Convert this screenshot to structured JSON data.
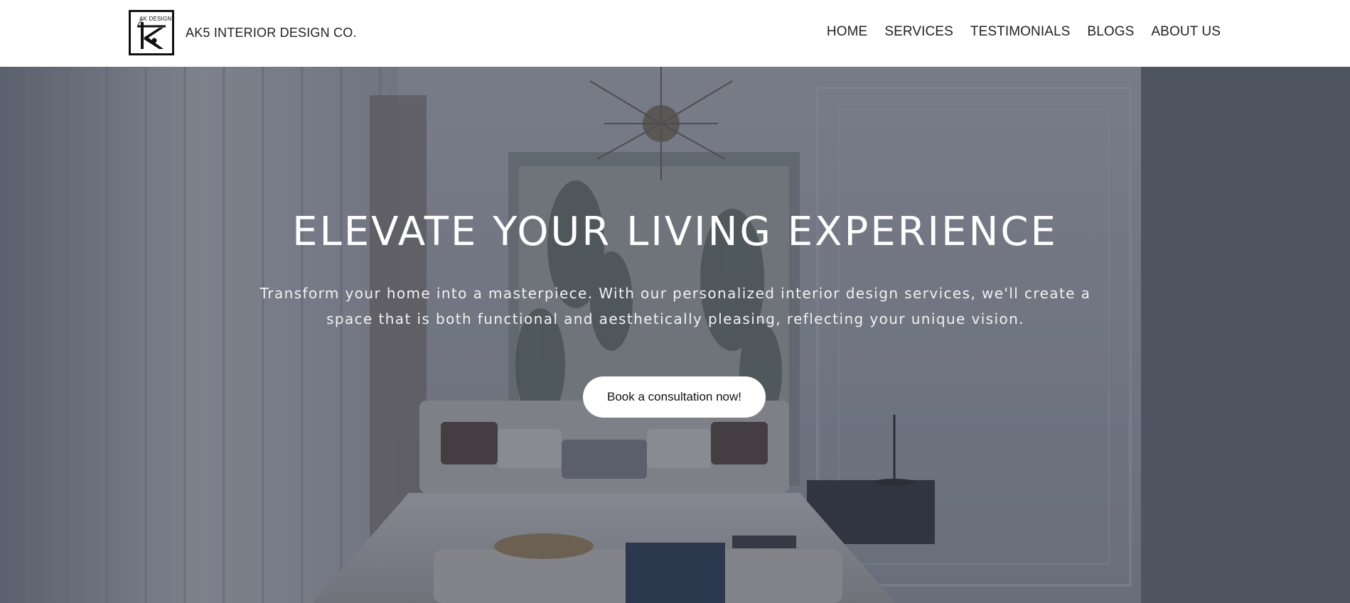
{
  "brand": {
    "name": "AK5 INTERIOR DESIGN CO.",
    "logo_text": "AK DESIGN"
  },
  "nav": {
    "items": [
      {
        "label": "HOME"
      },
      {
        "label": "SERVICES"
      },
      {
        "label": "TESTIMONIALS"
      },
      {
        "label": "BLOGS"
      },
      {
        "label": "ABOUT US"
      }
    ]
  },
  "hero": {
    "title": "ELEVATE YOUR LIVING EXPERIENCE",
    "subtitle": "Transform your home into a masterpiece. With our personalized interior design services, we'll create a space that is both functional and aesthetically pleasing, reflecting your unique vision.",
    "cta_label": "Book a consultation now!"
  },
  "colors": {
    "header_bg": "#ffffff",
    "nav_text": "#222222",
    "hero_overlay": "#343a4a",
    "cta_bg": "#ffffff",
    "hero_text": "#ffffff"
  },
  "icons": {
    "logo": "ak-design-logo-icon"
  }
}
